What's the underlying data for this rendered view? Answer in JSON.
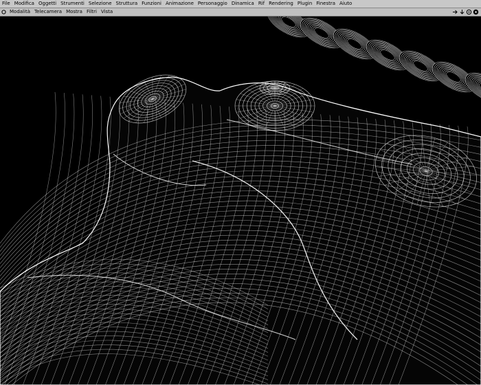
{
  "menubar": {
    "items": [
      "File",
      "Modifica",
      "Oggetti",
      "Strumenti",
      "Selezione",
      "Struttura",
      "Funzioni",
      "Animazione",
      "Personaggio",
      "Dinamica",
      "Rif",
      "Rendering",
      "Plugin",
      "Finestra",
      "Aiuto"
    ]
  },
  "panel": {
    "items": [
      "Modalità",
      "Telecamera",
      "Mostra",
      "Filtri",
      "Vista"
    ]
  },
  "viewport": {
    "render_mode": "wireframe",
    "background": "#000000",
    "wire_color": "#ffffff"
  }
}
